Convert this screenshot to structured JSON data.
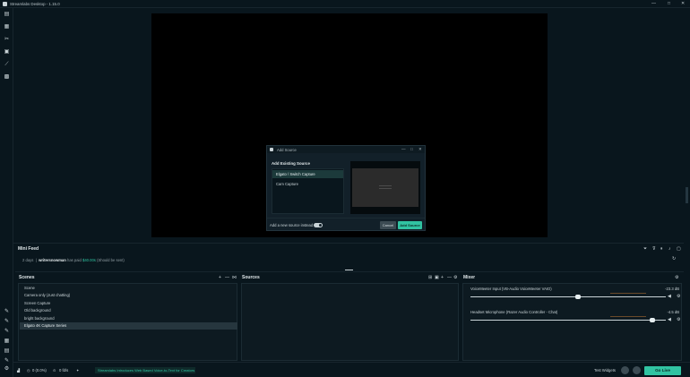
{
  "window": {
    "title": "Streamlabs Desktop - 1.15.0",
    "minimize": "—",
    "maximize": "□",
    "close": "✕"
  },
  "sidebar": {
    "icons": [
      "editor-icon",
      "themes-icon",
      "tools-icon",
      "store-icon",
      "stats-icon",
      "apps-icon"
    ],
    "bottom_icons": [
      "settings-icon",
      "highlighter-icon",
      "layout-icon",
      "cloudbot-icon",
      "dashboard-icon",
      "profile-icon",
      "gear-icon"
    ]
  },
  "dialog": {
    "title": "Add Source",
    "heading": "Add Existing Source",
    "sources": [
      "Elgato / Switch Capture",
      "Cam Capture"
    ],
    "selected_index": 0,
    "toggle_label": "Add a new source instead",
    "cancel_label": "Cancel",
    "add_label": "Add Source"
  },
  "minifeed": {
    "title": "Mini Feed",
    "time": "2 days",
    "name": "writersnowman",
    "action": "has paid",
    "amount": "$40.00s",
    "extra": "(Should be sent)"
  },
  "scenes": {
    "title": "Scenes",
    "items": [
      "Scene",
      "Camera only (Just chatting)",
      "Screen Capture",
      "Old background",
      "bright background",
      "Elgato 4K Capture Series"
    ],
    "selected_index": 5
  },
  "sources": {
    "title": "Sources"
  },
  "mixer": {
    "title": "Mixer",
    "channels": [
      {
        "name": "VoiceMeeter Input (VB-Audio VoiceMeeter VAIO)",
        "db": "-23.3 dB",
        "level": 0.55
      },
      {
        "name": "Headset Microphone (Razer Audio Controller - Chat)",
        "db": "-4.5 dB",
        "level": 0.93
      }
    ]
  },
  "statusbar": {
    "cpu": "0 (0.0%)",
    "fps": "0 fd/s",
    "notification": "Streamlabs Introduces Web Based Voice-to-Text for Creators",
    "test_widgets": "Test Widgets",
    "go_live": "Go Live"
  },
  "colors": {
    "accent": "#31c3a2",
    "background": "#09161d",
    "panel": "#0d1a21"
  }
}
